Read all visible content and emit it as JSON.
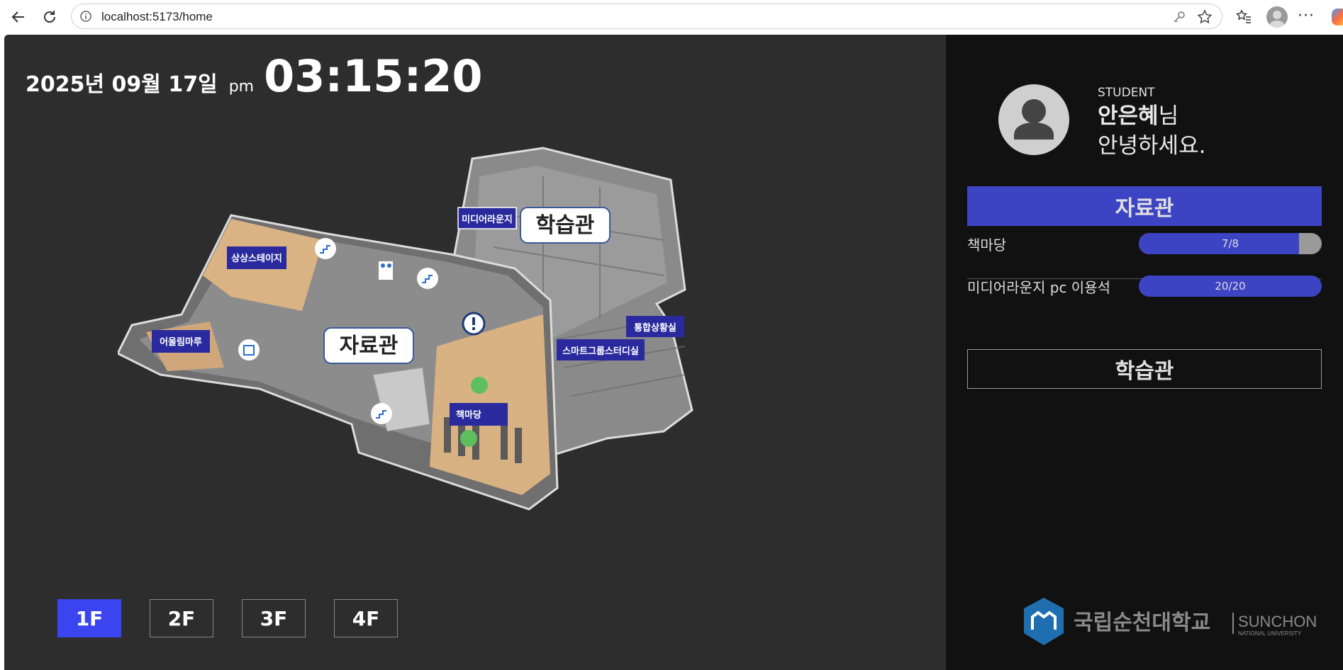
{
  "browser": {
    "url": "localhost:5173/home"
  },
  "header": {
    "date": "2025년 09월 17일",
    "ampm": "pm",
    "time": "03:15:20"
  },
  "map": {
    "building_labels": [
      "자료관",
      "학습관"
    ],
    "room_labels": [
      "미디어라운지",
      "상상스테이지",
      "어울림마루",
      "통합상황실",
      "스마트그룹스터디실",
      "책마당"
    ]
  },
  "floors": [
    "1F",
    "2F",
    "3F",
    "4F"
  ],
  "active_floor": "1F",
  "user": {
    "role": "STUDENT",
    "name": "안은혜",
    "suffix": "님",
    "greeting": "안녕하세요."
  },
  "panel": {
    "building_active": "자료관",
    "building_other": "학습관",
    "rooms": [
      {
        "label": "책마당",
        "value": "7/8",
        "fill_ratio": 0.875
      },
      {
        "label": "미디어라운지 pc 이용석",
        "value": "20/20",
        "fill_ratio": 1.0
      }
    ]
  },
  "logo": {
    "text_ko": "국립순천대학교",
    "text_en": "SUNCHON",
    "text_en_sub": "NATIONAL UNIVERSITY"
  },
  "colors": {
    "accent": "#3d44c4",
    "floor_active": "#3a45f0",
    "label_bg": "#2a2a9e"
  }
}
